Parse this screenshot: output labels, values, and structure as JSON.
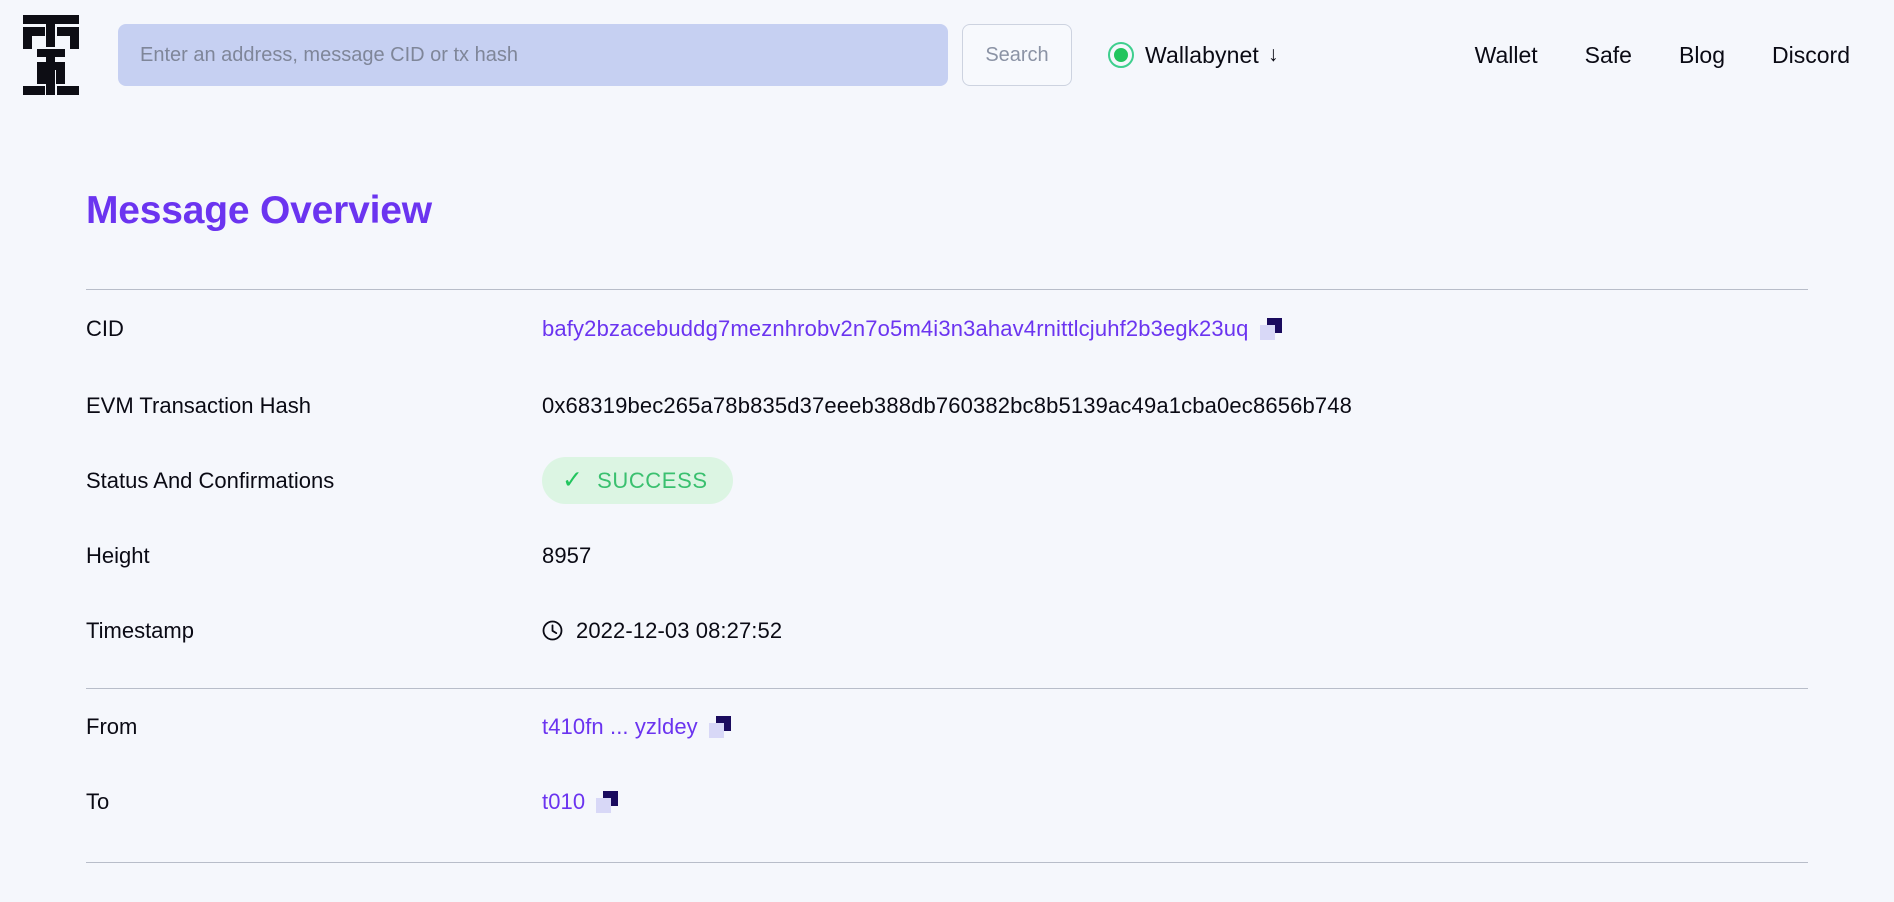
{
  "brand": {
    "logo_icon": "filecoin-fvm-logo-icon"
  },
  "search": {
    "placeholder": "Enter an address, message CID or tx hash",
    "value": "",
    "button_label": "Search"
  },
  "network": {
    "label": "Wallabynet",
    "caret": "↓",
    "status_color": "#22c55e"
  },
  "nav": {
    "items": [
      {
        "label": "Wallet"
      },
      {
        "label": "Safe"
      },
      {
        "label": "Blog"
      },
      {
        "label": "Discord"
      }
    ]
  },
  "page": {
    "title": "Message Overview",
    "title_color": "#6b34f0"
  },
  "overview": {
    "rows": [
      {
        "label": "CID",
        "value": "bafy2bzacebuddg7meznhrobv2n7o5m4i3n3ahav4rnittlcjuhf2b3egk23uq"
      },
      {
        "label": "EVM Transaction Hash",
        "value": "0x68319bec265a78b835d37eeeb388db760382bc8b5139ac49a1cba0ec8656b748"
      },
      {
        "label": "Status And Confirmations",
        "value": "SUCCESS",
        "check": "✓"
      },
      {
        "label": "Height",
        "value": "8957"
      },
      {
        "label": "Timestamp",
        "value": "2022-12-03 08:27:52"
      }
    ]
  },
  "parties": {
    "rows": [
      {
        "label": "From",
        "value": "t410fn ... yzldey"
      },
      {
        "label": "To",
        "value": "t010"
      }
    ]
  },
  "colors": {
    "background": "#f5f7fc",
    "accent_purple": "#6b34f0",
    "search_field": "#c6d0f2",
    "success_bg": "#dcf5e3",
    "success_text": "#3ac06f",
    "divider": "#b8bdc9"
  }
}
